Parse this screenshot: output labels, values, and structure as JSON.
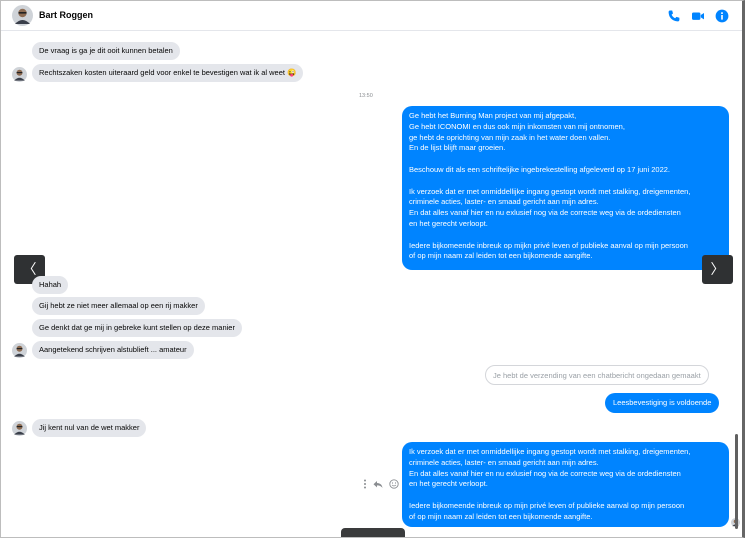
{
  "header": {
    "contact_name": "Bart Roggen",
    "icons": [
      "phone-icon",
      "video-camera-icon",
      "info-icon"
    ],
    "accent_color": "#0084ff"
  },
  "timestamp": "13:50",
  "messages_top": {
    "m1": "De vraag is ga je dit ooit kunnen betalen",
    "m2": "Rechtszaken kosten uiteraard geld voor enkel te bevestigen wat ik al weet 😜"
  },
  "outgoing_long": {
    "lines": [
      "Ge hebt het Burning Man project van mij afgepakt,",
      "Ge hebt ICONOMI en dus ook mijn inkomsten van mij ontnomen,",
      "ge hebt de oprichting van mijn zaak in het water doen vallen.",
      "En de lijst blijft maar groeien.",
      "",
      "Beschouw dit als een schriftelijke ingebrekestelling afgeleverd op 17 juni 2022.",
      "",
      "Ik verzoek dat er met onmiddellijke ingang gestopt wordt met stalking, dreigementen,",
      "criminele acties, laster- en smaad gericht aan mijn adres.",
      "En dat alles vanaf hier en nu exlusief nog via de correcte weg via de ordediensten",
      "en het gerecht verloopt.",
      "",
      "Iedere bijkomeende inbreuk op mijkn privé leven of publieke aanval op mijn persoon",
      "of op mijn naam zal leiden tot een bijkomende aangifte."
    ]
  },
  "messages_middle": {
    "m1": "Hahah",
    "m2": "Gij hebt ze niet meer allemaal op een rij makker",
    "m3": "Ge denkt dat ge mij in gebreke kunt stellen op deze manier",
    "m4": "Aangetekend schrijven alstublieft ... amateur"
  },
  "unsent_notice": "Je hebt de verzending van een chatbericht ongedaan gemaakt",
  "outgoing_short": "Leesbevestiging is voldoende",
  "incoming_last": "Jij kent nul van de wet makker",
  "outgoing_final": {
    "lines": [
      "Ik verzoek dat er met onmiddellijke ingang gestopt wordt met stalking, dreigementen,",
      "criminele acties, laster- en smaad gericht aan mijn adres.",
      "En dat alles vanaf hier en nu exlusief nog via de correcte weg via de ordediensten",
      "en het gerecht verloopt.",
      "",
      "Iedere bijkomeende inbreuk op mijn privé leven of publieke aanval op mijn persoon",
      "of op mijn naam zal leiden tot een bijkomende aangifte."
    ]
  },
  "nav": {
    "prev": "〈",
    "next": "〉"
  },
  "message_actions": [
    "more-icon",
    "reply-icon",
    "react-icon"
  ]
}
